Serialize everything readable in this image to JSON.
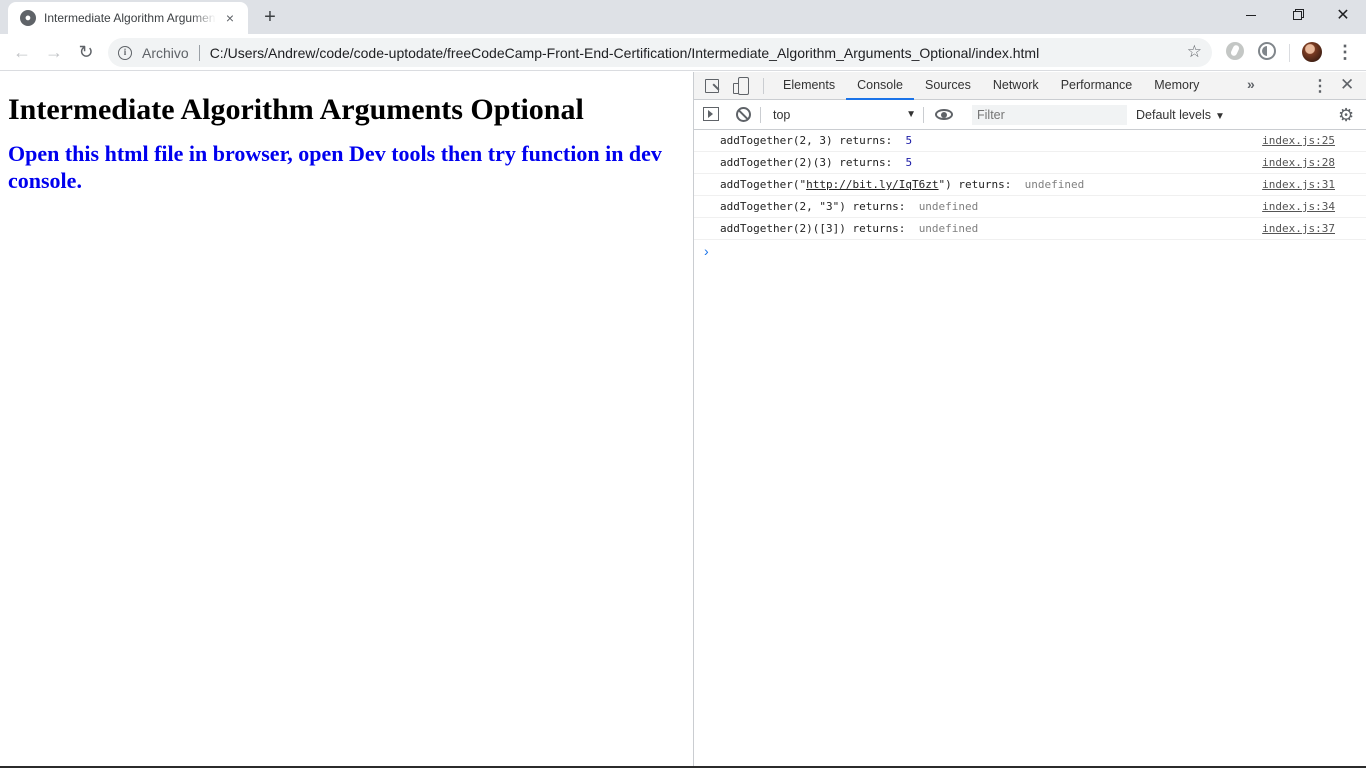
{
  "tab": {
    "title": "Intermediate Algorithm Arguments Optional",
    "close_icon": "×",
    "new_tab": "+"
  },
  "window": {
    "close": "✕"
  },
  "toolbar": {
    "back": "←",
    "forward": "→",
    "reload": "↻",
    "security_label": "Archivo",
    "url": "C:/Users/Andrew/code/code-uptodate/freeCodeCamp-Front-End-Certification/Intermediate_Algorithm_Arguments_Optional/index.html",
    "star": "☆",
    "menu": "⋮"
  },
  "page": {
    "heading": "Intermediate Algorithm Arguments Optional",
    "subheading": "Open this html file in browser, open Dev tools then try function in dev console."
  },
  "devtools": {
    "tabs": [
      "Elements",
      "Console",
      "Sources",
      "Network",
      "Performance",
      "Memory"
    ],
    "active_tab": "Console",
    "more": "»",
    "kebab": "⋮",
    "close": "✕",
    "console_bar": {
      "context": "top",
      "filter_placeholder": "Filter",
      "levels": "Default levels",
      "gear": "⚙"
    },
    "logs": [
      {
        "prefix": "addTogether(2, 3) returns:  ",
        "link": "",
        "suffix": "",
        "value": "5",
        "value_type": "number",
        "source": "index.js:25"
      },
      {
        "prefix": "addTogether(2)(3) returns:  ",
        "link": "",
        "suffix": "",
        "value": "5",
        "value_type": "number",
        "source": "index.js:28"
      },
      {
        "prefix": "addTogether(\"",
        "link": "http://bit.ly/IqT6zt",
        "suffix": "\") returns:  ",
        "value": "undefined",
        "value_type": "undefined",
        "source": "index.js:31"
      },
      {
        "prefix": "addTogether(2, \"3\") returns:  ",
        "link": "",
        "suffix": "",
        "value": "undefined",
        "value_type": "undefined",
        "source": "index.js:34"
      },
      {
        "prefix": "addTogether(2)([3]) returns:  ",
        "link": "",
        "suffix": "",
        "value": "undefined",
        "value_type": "undefined",
        "source": "index.js:37"
      }
    ],
    "prompt": "›"
  }
}
